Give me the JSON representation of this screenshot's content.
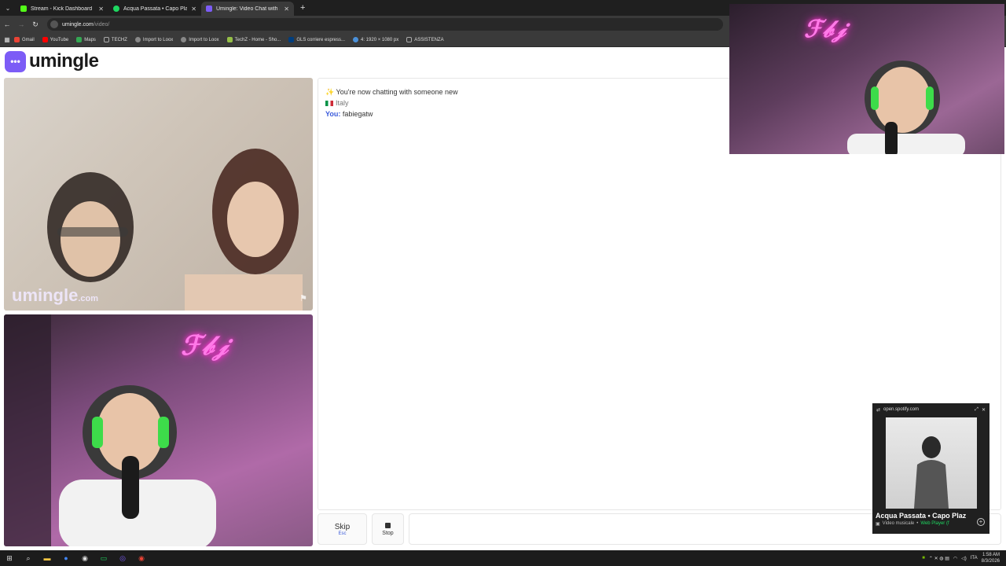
{
  "browser": {
    "tabs": [
      {
        "title": "Stream - Kick Dashboard",
        "color": "#53fc18"
      },
      {
        "title": "Acqua Passata • Capo Plaza",
        "color": "#1ed760"
      },
      {
        "title": "Umingle: Video Chat with S",
        "color": "#7c5cf6",
        "active": true
      }
    ],
    "new_tab": "+",
    "address": {
      "domain": "umingle.com",
      "path": "/video/"
    },
    "bookmarks": [
      {
        "label": "Gmail",
        "color": "#ea4335"
      },
      {
        "label": "YouTube",
        "color": "#ff0000"
      },
      {
        "label": "Maps",
        "color": "#34a853"
      },
      {
        "label": "TECHZ",
        "color": "#888888"
      },
      {
        "label": "Import to Loox",
        "color": "#888888"
      },
      {
        "label": "Import to Loox",
        "color": "#888888"
      },
      {
        "label": "TechZ - Home - Sho...",
        "color": "#95bf47"
      },
      {
        "label": "GLS corriere espress...",
        "color": "#003e7e"
      },
      {
        "label": "4: 1920 × 1080 px",
        "color": "#4a90d9"
      },
      {
        "label": "ASSISTENZA",
        "color": "#888888"
      }
    ]
  },
  "site": {
    "logo_text": "umingle",
    "watermark": {
      "name": "umingle",
      "tld": ".com"
    }
  },
  "chat": {
    "m1": "You're now chatting with someone new",
    "m2": "Italy",
    "m3_label": "You:",
    "m3_text": "fabiegatw"
  },
  "controls": {
    "skip_label": "Skip",
    "skip_hint": "Esc",
    "stop_label": "Stop"
  },
  "spotify": {
    "domain": "open.spotify.com",
    "title": "Acqua Passata • Capo Plaz",
    "subtitle": "Video musicale",
    "source": "Web Player (f"
  },
  "taskbar": {
    "lang": "ITA",
    "time": "1:58 AM",
    "date": "8/3/2026"
  }
}
